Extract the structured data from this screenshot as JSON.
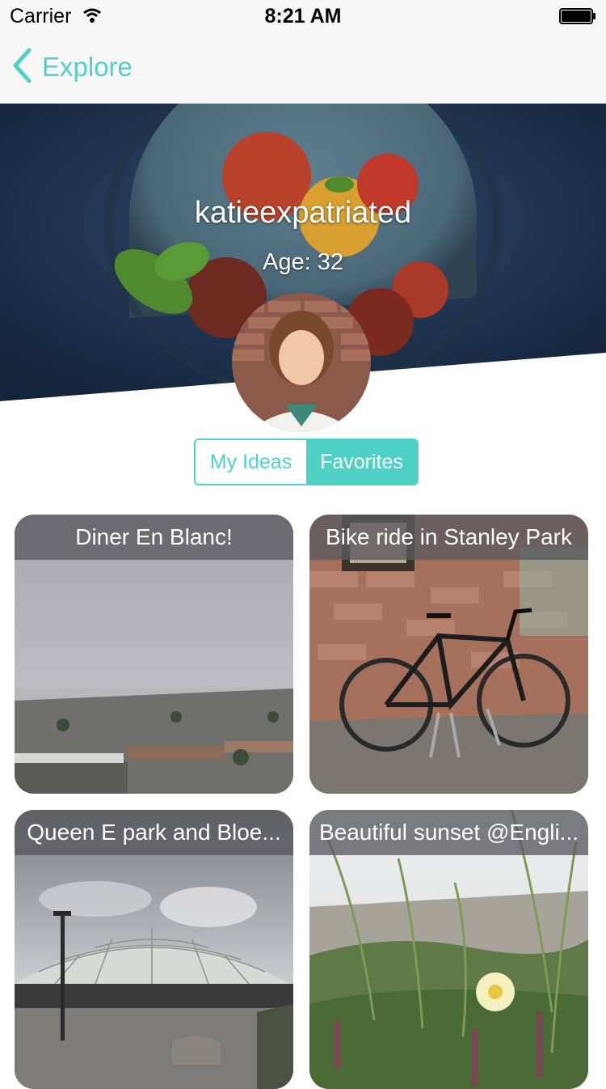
{
  "status_bar": {
    "carrier": "Carrier",
    "time": "8:21 AM"
  },
  "nav": {
    "back_label": "Explore"
  },
  "profile": {
    "username": "katieexpatriated",
    "age": "Age: 32"
  },
  "segments": {
    "my_ideas": "My Ideas",
    "favorites": "Favorites",
    "selected": "Favorites"
  },
  "cards": [
    {
      "title": "Diner En Blanc!"
    },
    {
      "title": "Bike ride in Stanley Park"
    },
    {
      "title": "Queen E park and Bloe..."
    },
    {
      "title": "Beautiful sunset @Engli..."
    }
  ],
  "colors": {
    "accent": "#4fd1c5",
    "nav_bg": "#f7f7f7",
    "card_title_bg": "#5a5a5f"
  }
}
